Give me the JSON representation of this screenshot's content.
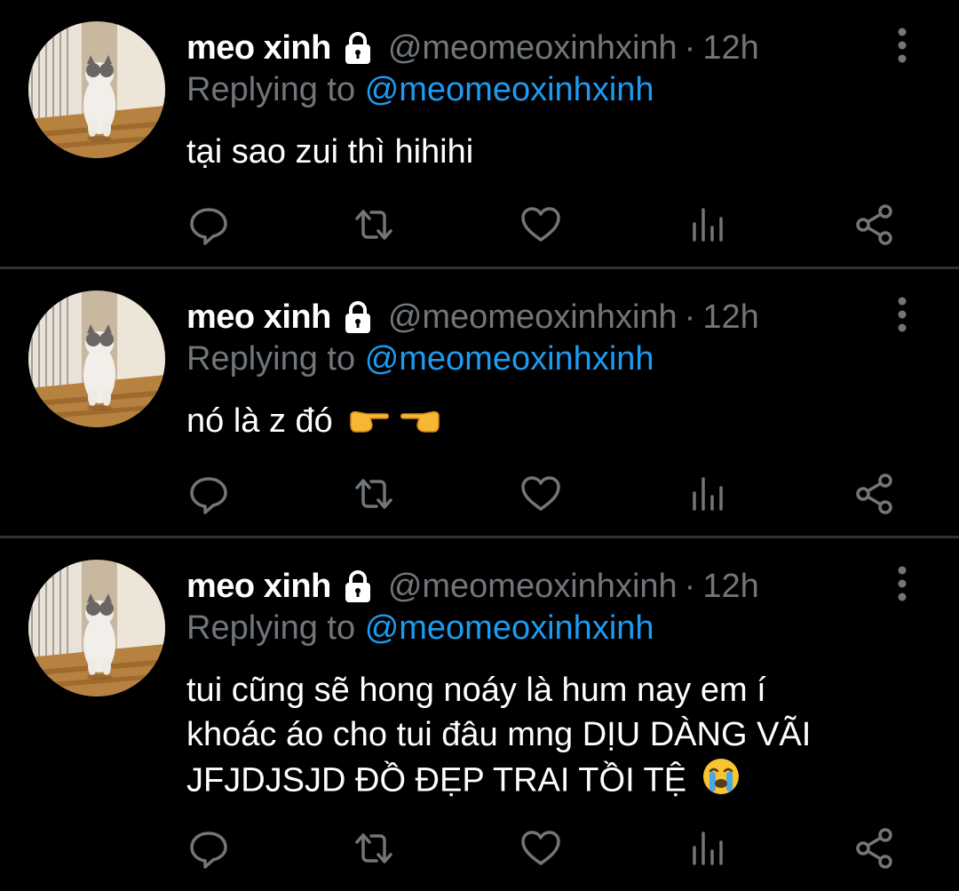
{
  "colors": {
    "background": "#000000",
    "name": "#ffffff",
    "secondary": "#71767b",
    "mention": "#1d9bf0",
    "divider": "#2f3336"
  },
  "tweets": [
    {
      "name": "meo xinh",
      "handle": "@meomeoxinhxinh",
      "separator": "·",
      "time": "12h",
      "replying_prefix": "Replying to",
      "replying_to": "@meomeoxinhxinh",
      "text": "tại sao zui thì hihihi",
      "emoji": []
    },
    {
      "name": "meo xinh",
      "handle": "@meomeoxinhxinh",
      "separator": "·",
      "time": "12h",
      "replying_prefix": "Replying to",
      "replying_to": "@meomeoxinhxinh",
      "text": "nó là z đó",
      "emoji": [
        "pointing-right-emoji",
        "pointing-left-emoji"
      ]
    },
    {
      "name": "meo xinh",
      "handle": "@meomeoxinhxinh",
      "separator": "·",
      "time": "12h",
      "replying_prefix": "Replying to",
      "replying_to": "@meomeoxinhxinh",
      "text_lines": [
        "tui cũng sẽ hong noáy là hum nay em í",
        "khoác áo cho tui đâu mng DỊU DÀNG VÃI",
        "JFJDJSJD ĐỒ ĐẸP TRAI TỒI TỆ"
      ],
      "emoji": [
        "loudly-crying-emoji"
      ]
    }
  ],
  "icons": {
    "locked": "lock-icon",
    "more": "more-vertical-icon",
    "reply": "reply-icon",
    "retweet": "retweet-icon",
    "like": "heart-icon",
    "views": "analytics-icon",
    "share": "share-icon"
  }
}
